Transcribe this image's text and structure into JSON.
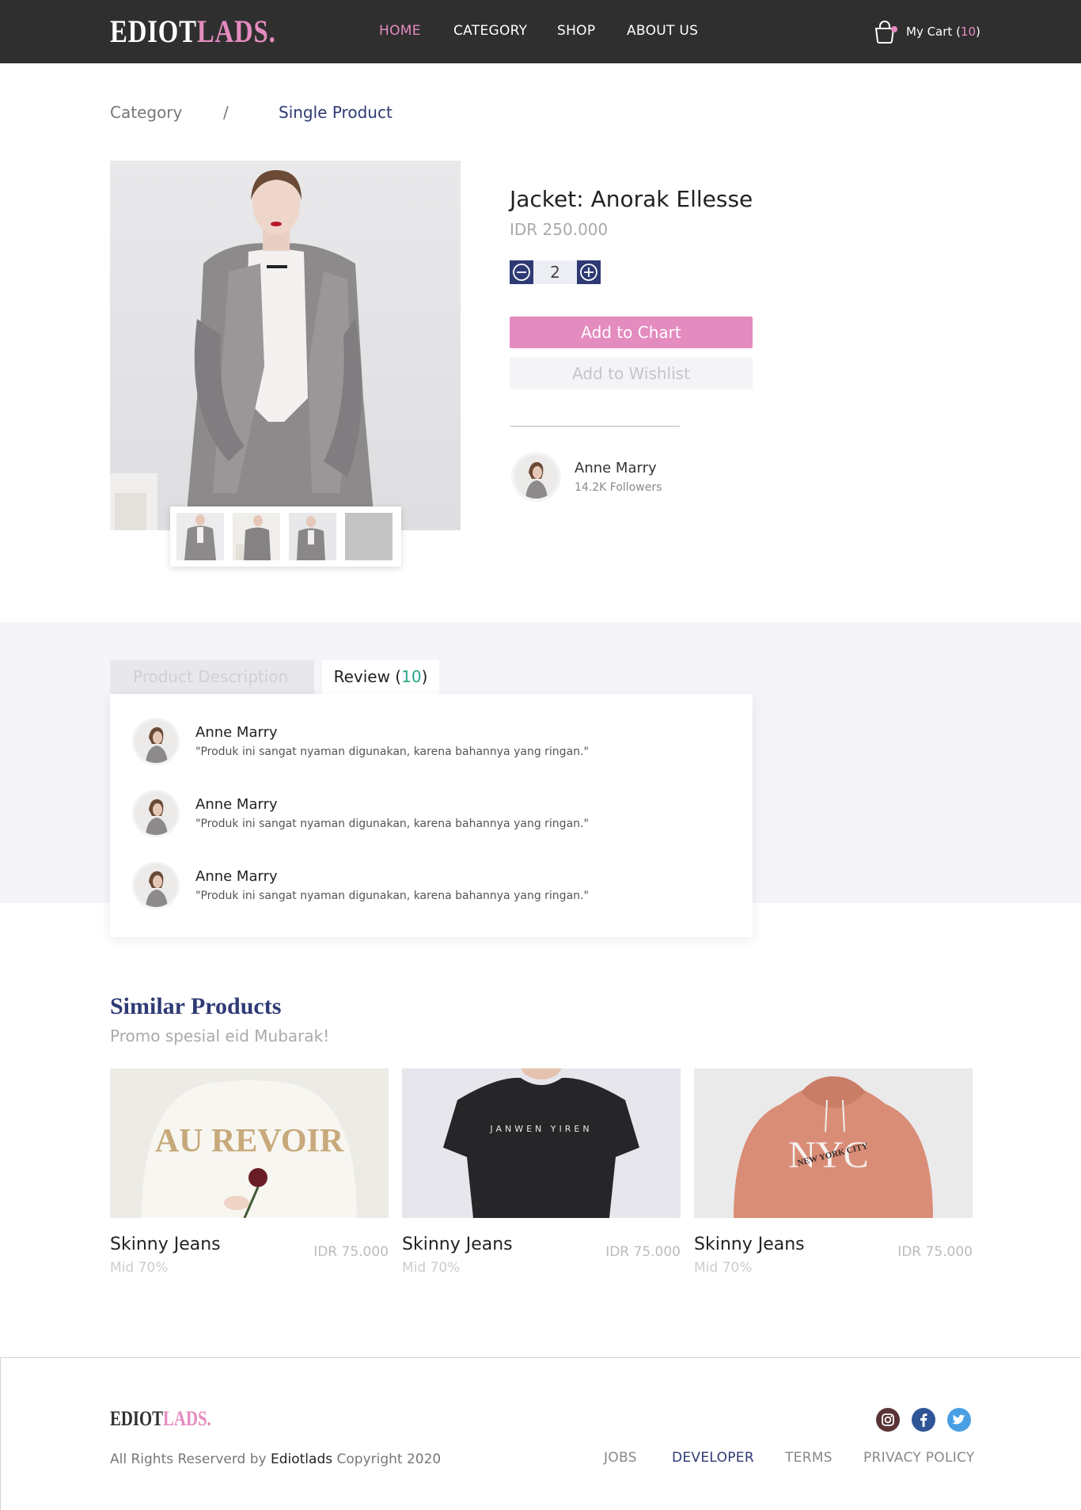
{
  "header": {
    "logo_part1": "EDIOT",
    "logo_part2": "LADS.",
    "nav": [
      "HOME",
      "CATEGORY",
      "SHOP",
      "ABOUT US"
    ],
    "cart_label": "My Cart (",
    "cart_count": "10",
    "cart_close": ")"
  },
  "breadcrumb": {
    "parent": "Category",
    "separator": "/",
    "current": "Single Product"
  },
  "product": {
    "title": "Jacket: Anorak Ellesse",
    "price": "IDR 250.000",
    "quantity": "2",
    "add_to_cart": "Add to Chart",
    "add_to_wishlist": "Add to Wishlist"
  },
  "seller": {
    "name": "Anne Marry",
    "followers": "14.2K Followers"
  },
  "tabs": {
    "description": "Product Description",
    "review_label": "Review (",
    "review_count": "10",
    "review_close": ")"
  },
  "reviews": [
    {
      "name": "Anne Marry",
      "text": "\"Produk ini sangat nyaman digunakan, karena bahannya yang ringan.\""
    },
    {
      "name": "Anne Marry",
      "text": "\"Produk ini sangat nyaman digunakan, karena bahannya yang ringan.\""
    },
    {
      "name": "Anne Marry",
      "text": "\"Produk ini sangat nyaman digunakan, karena bahannya yang ringan.\""
    }
  ],
  "similar": {
    "title": "Similar Products",
    "subtitle": "Promo spesial eid Mubarak!",
    "items": [
      {
        "name": "Skinny Jeans",
        "price": "IDR 75.000",
        "discount": "Mid 70%",
        "print": "AU REVOIR"
      },
      {
        "name": "Skinny Jeans",
        "price": "IDR 75.000",
        "discount": "Mid 70%",
        "print": "JANWEN YIREN"
      },
      {
        "name": "Skinny Jeans",
        "price": "IDR 75.000",
        "discount": "Mid 70%",
        "print": "NYC",
        "print_small": "NEW YORK CITY"
      }
    ]
  },
  "footer": {
    "logo_part1": "EDIOT",
    "logo_part2": "LADS.",
    "copy_prefix": "All Rights Reserverd by ",
    "copy_brand": "Ediotlads",
    "copy_suffix": " Copyright 2020",
    "links": [
      "JOBS",
      "DEVELOPER",
      "TERMS",
      "PRIVACY POLICY"
    ],
    "social": [
      "instagram-icon",
      "facebook-icon",
      "twitter-icon"
    ]
  },
  "colors": {
    "accent_pink": "#e48bbf",
    "navy": "#2e3a74",
    "header_bg": "#2f2f2f",
    "review_count_green": "#2ba58a"
  }
}
